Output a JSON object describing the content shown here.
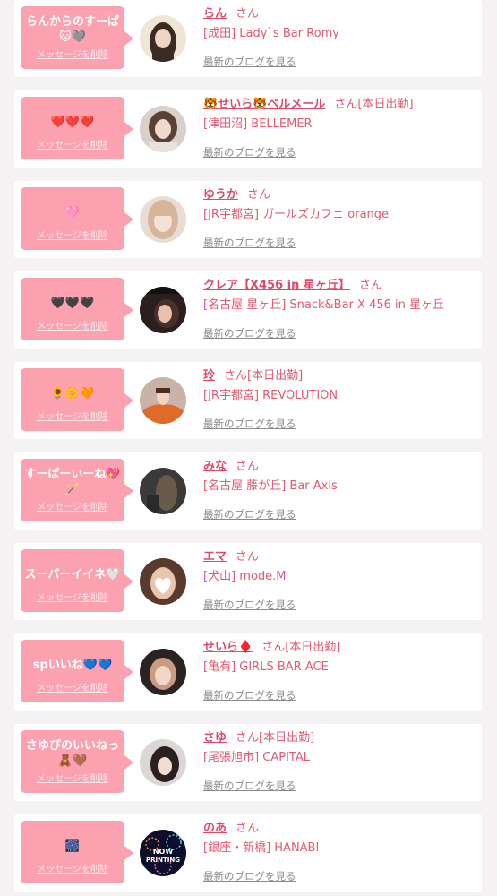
{
  "delete_label": "メッセージを削除",
  "blog_label": "最新のブログを見る",
  "san_label": "さん",
  "accent": "#e04a6a",
  "bubble_color": "#fca1b0",
  "cards": [
    {
      "message": "らんからのすーぱ🐱🩶",
      "name": "らん",
      "work": "",
      "shop": "[成田] Lady`s Bar Romy"
    },
    {
      "message": "❤️❤️❤️",
      "name": "🐯せいら🐯ベルメール",
      "work": "[本日出勤]",
      "shop": "[津田沼] BELLEMER"
    },
    {
      "message": "🩷",
      "name": "ゆうか",
      "work": "",
      "shop": "[JR宇都宮] ガールズカフェ orange"
    },
    {
      "message": "🖤🖤🖤",
      "name": "クレア【X456 in 星ヶ丘】",
      "work": "",
      "shop": "[名古屋 星ヶ丘] Snack&Bar X 456 in 星ヶ丘"
    },
    {
      "message": "🌻🌼🧡",
      "name": "玲",
      "work": "[本日出勤]",
      "shop": "[JR宇都宮] REVOLUTION"
    },
    {
      "message": "すーぱーいーね💖🪄",
      "name": "みな",
      "work": "",
      "shop": "[名古屋 藤が丘] Bar Axis"
    },
    {
      "message": "スーパーイイネ🤍",
      "name": "エマ",
      "work": "",
      "shop": "[犬山] mode.M"
    },
    {
      "message": "spいいね💙💙",
      "name": "せいら♦️",
      "work": "[本日出勤]",
      "shop": "[亀有] GIRLS BAR ACE"
    },
    {
      "message": "さゆぴのいいねっ🧸🤎",
      "name": "さゆ",
      "work": "[本日出勤]",
      "shop": "[尾張旭市] CAPITAL"
    },
    {
      "message": "🎆",
      "name": "のあ",
      "work": "",
      "shop": "[銀座・新橋] HANABI"
    }
  ],
  "now_printing": [
    "NOW",
    "PRINTING"
  ]
}
